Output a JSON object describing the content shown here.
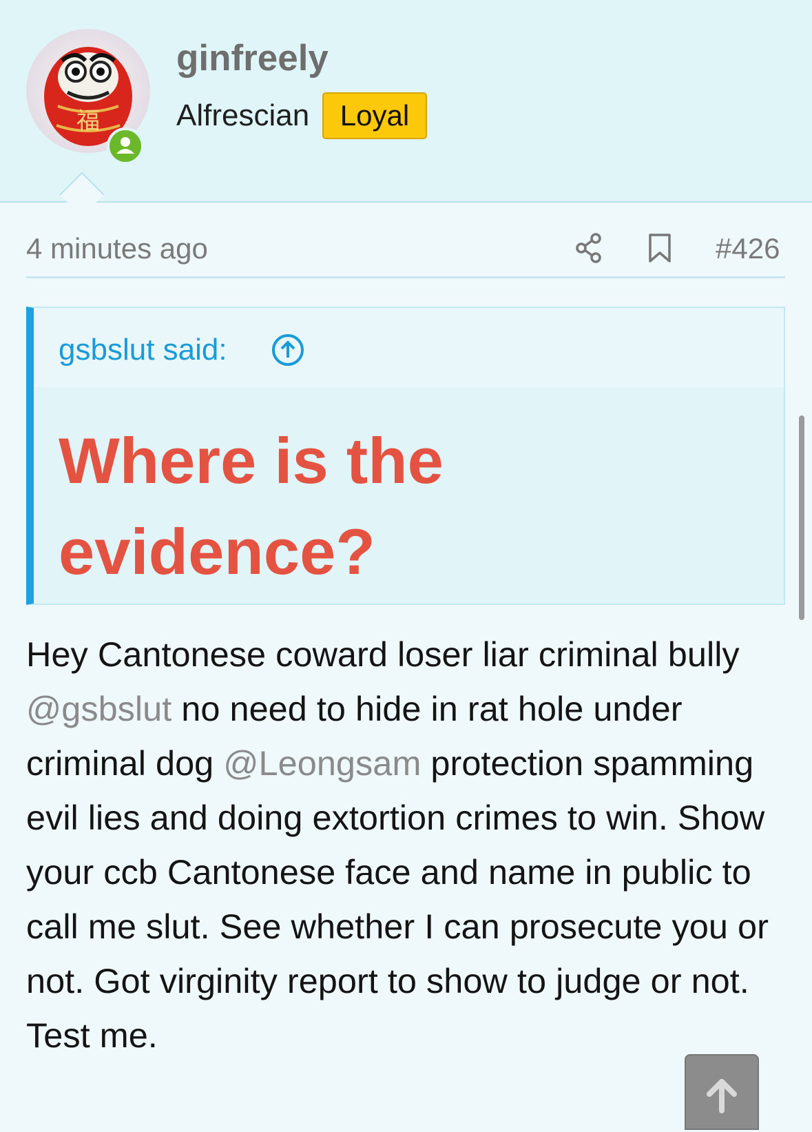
{
  "post": {
    "author": {
      "username": "ginfreely",
      "title": "Alfrescian",
      "badge": "Loyal",
      "avatar_icon": "daruma-avatar",
      "status_icon": "online-user-icon"
    },
    "time": "4 minutes ago",
    "number": "#426",
    "actions": {
      "share_icon": "share-icon",
      "bookmark_icon": "bookmark-icon"
    },
    "quote": {
      "author_label": "gsbslut said:",
      "jump_icon": "arrow-up-circle-icon",
      "text": "Where is the evidence?"
    },
    "body": {
      "seg1": "Hey Cantonese coward loser liar criminal bully ",
      "mention1": "@gsbslut",
      "seg2": " no need to hide in rat hole under criminal dog ",
      "mention2": "@Leongsam",
      "seg3": " protection spamming evil lies and doing extortion crimes to win. Show your ccb Cantonese face and name in public to call me slut. See whether I can prosecute you or not. Got virginity report to show to judge or not. Test me."
    }
  },
  "colors": {
    "header_bg": "#e0f5f8",
    "badge_bg": "#fcc80a",
    "quote_accent": "#1da1e0",
    "quote_text": "#e45241",
    "online": "#6bb82a"
  },
  "scroll_to_top_icon": "arrow-up-icon"
}
